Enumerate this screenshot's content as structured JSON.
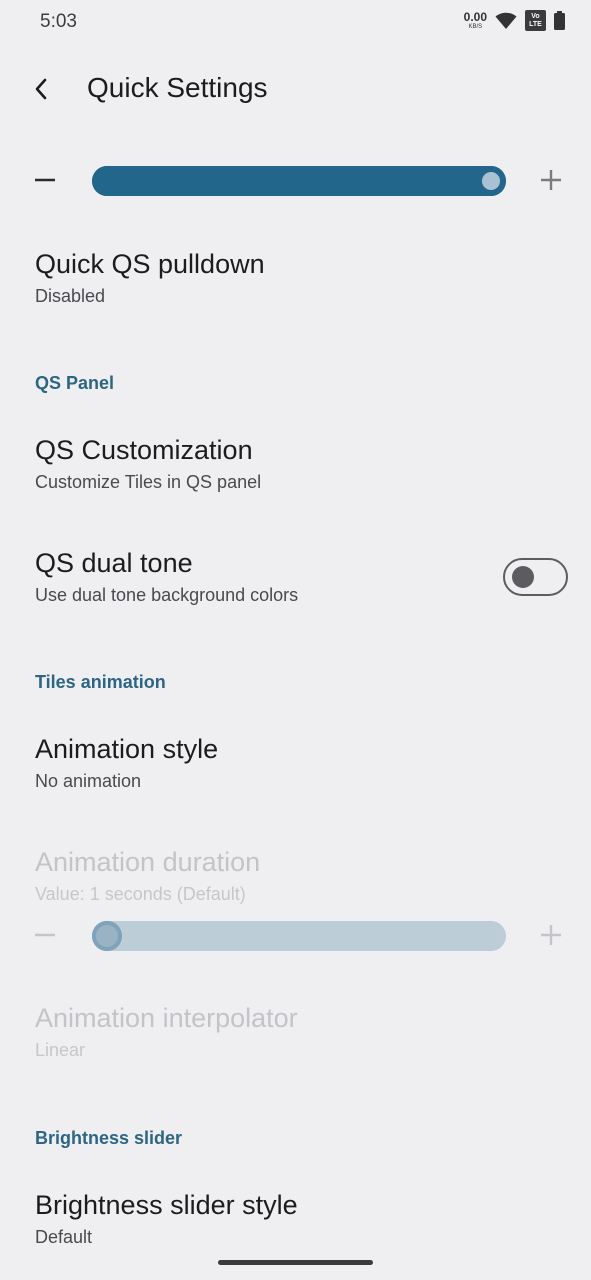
{
  "status_bar": {
    "time": "5:03",
    "net_speed_value": "0.00",
    "net_speed_unit": "KB/S",
    "volte_top": "Vo",
    "volte_bottom": "LTE"
  },
  "toolbar": {
    "title": "Quick Settings",
    "back_icon": "chevron-left-icon"
  },
  "top_slider": {
    "value_fraction": 1.0,
    "minus_icon": "minus-icon",
    "plus_icon": "plus-icon",
    "accent_color": "#23668c"
  },
  "items": {
    "quick_pulldown": {
      "title": "Quick QS pulldown",
      "summary": "Disabled"
    },
    "qs_customization": {
      "title": "QS Customization",
      "summary": "Customize Tiles in QS panel"
    },
    "qs_dual_tone": {
      "title": "QS dual tone",
      "summary": "Use dual tone background colors",
      "enabled": false
    },
    "animation_style": {
      "title": "Animation style",
      "summary": "No animation"
    },
    "animation_duration": {
      "title": "Animation duration",
      "summary": "Value: 1 seconds (Default)",
      "disabled": true
    },
    "animation_interpolator": {
      "title": "Animation interpolator",
      "summary": "Linear",
      "disabled": true
    },
    "brightness_slider_style": {
      "title": "Brightness slider style",
      "summary": "Default"
    }
  },
  "sections": {
    "qs_panel": "QS Panel",
    "tiles_animation": "Tiles animation",
    "brightness_slider": "Brightness slider"
  },
  "duration_slider": {
    "value_fraction": 0.0,
    "disabled": true,
    "track_color": "#bccdd8"
  },
  "colors": {
    "background": "#efeff2",
    "accent": "#23668c",
    "section_header": "#2c6683"
  }
}
